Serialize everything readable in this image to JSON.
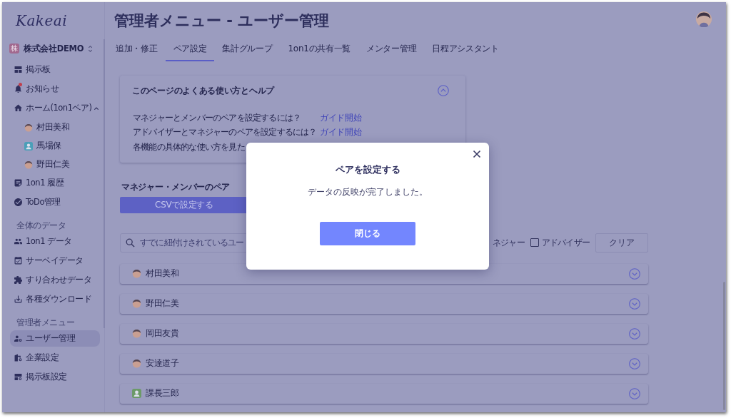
{
  "sidebar": {
    "logo": "Kakeai",
    "company": {
      "badge": "株",
      "name": "株式会社DEMO"
    },
    "groups": [
      {
        "items": [
          {
            "label": "掲示板",
            "selected": false,
            "unread": false
          },
          {
            "label": "お知らせ",
            "selected": false,
            "unread": true
          },
          {
            "label": "ホーム(1on1ペア)",
            "selected": false,
            "unread": false,
            "expanded": true,
            "children": [
              {
                "label": "村田美和",
                "kind": "illustration",
                "selected": false
              },
              {
                "label": "馬場保",
                "kind": "default",
                "color": "#4b9fb8",
                "selected": false
              },
              {
                "label": "野田仁美",
                "kind": "illustration",
                "selected": false
              }
            ]
          },
          {
            "label": "1on1 履歴",
            "selected": false,
            "unread": false
          },
          {
            "label": "ToDo管理",
            "selected": false,
            "unread": false
          }
        ]
      },
      {
        "heading": "全体のデータ",
        "items": [
          {
            "label": "1on1 データ",
            "selected": false,
            "unread": false
          },
          {
            "label": "サーベイデータ",
            "selected": false,
            "unread": false
          },
          {
            "label": "すり合わせデータ",
            "selected": false,
            "unread": false
          },
          {
            "label": "各種ダウンロード",
            "selected": false,
            "unread": false
          }
        ]
      },
      {
        "heading": "管理者メニュー",
        "items": [
          {
            "label": "ユーザー管理",
            "selected": true,
            "unread": false
          },
          {
            "label": "企業設定",
            "selected": false,
            "unread": false
          },
          {
            "label": "掲示板設定",
            "selected": false,
            "unread": false
          }
        ]
      }
    ]
  },
  "header": {
    "title": "管理者メニュー - ユーザー管理"
  },
  "tabs": [
    {
      "label": "追加・修正",
      "selected": false
    },
    {
      "label": "ペア設定",
      "selected": true
    },
    {
      "label": "集計グループ",
      "selected": false
    },
    {
      "label": "1on1の共有一覧",
      "selected": false
    },
    {
      "label": "メンター管理",
      "selected": false
    },
    {
      "label": "日程アシスタント",
      "selected": false
    }
  ],
  "help": {
    "title": "このページのよくある使い方とヘルプ",
    "expanded": true,
    "rows": [
      {
        "question": "マネジャーとメンバーのペアを設定するには？",
        "link": "ガイド開始"
      },
      {
        "question": "アドバイザーとマネジャーのペアを設定するには？",
        "link": "ガイド開始"
      },
      {
        "question": "各機能の具体的な使い方を見た"
      }
    ]
  },
  "pairs": {
    "heading": "マネジャー・メンバーのペア",
    "csv_button": "CSVで設定する",
    "search": {
      "placeholder": "すでに紐付けされているユー"
    },
    "filters": [
      {
        "label": "ネジャー"
      },
      {
        "label": "アドバイザー",
        "checked": false
      }
    ],
    "clear_button": "クリア",
    "members": [
      {
        "name": "村田美和",
        "kind": "illustration",
        "expanded": false
      },
      {
        "name": "野田仁美",
        "kind": "illustration",
        "expanded": false
      },
      {
        "name": "岡田友貴",
        "kind": "illustration",
        "expanded": false
      },
      {
        "name": "安達道子",
        "kind": "illustration",
        "expanded": false
      },
      {
        "name": "課長三郎",
        "kind": "default",
        "color": "#6c9a68",
        "expanded": false
      }
    ]
  },
  "modal": {
    "title": "ペアを設定する",
    "message": "データの反映が完了しました。",
    "button": "閉じる"
  }
}
